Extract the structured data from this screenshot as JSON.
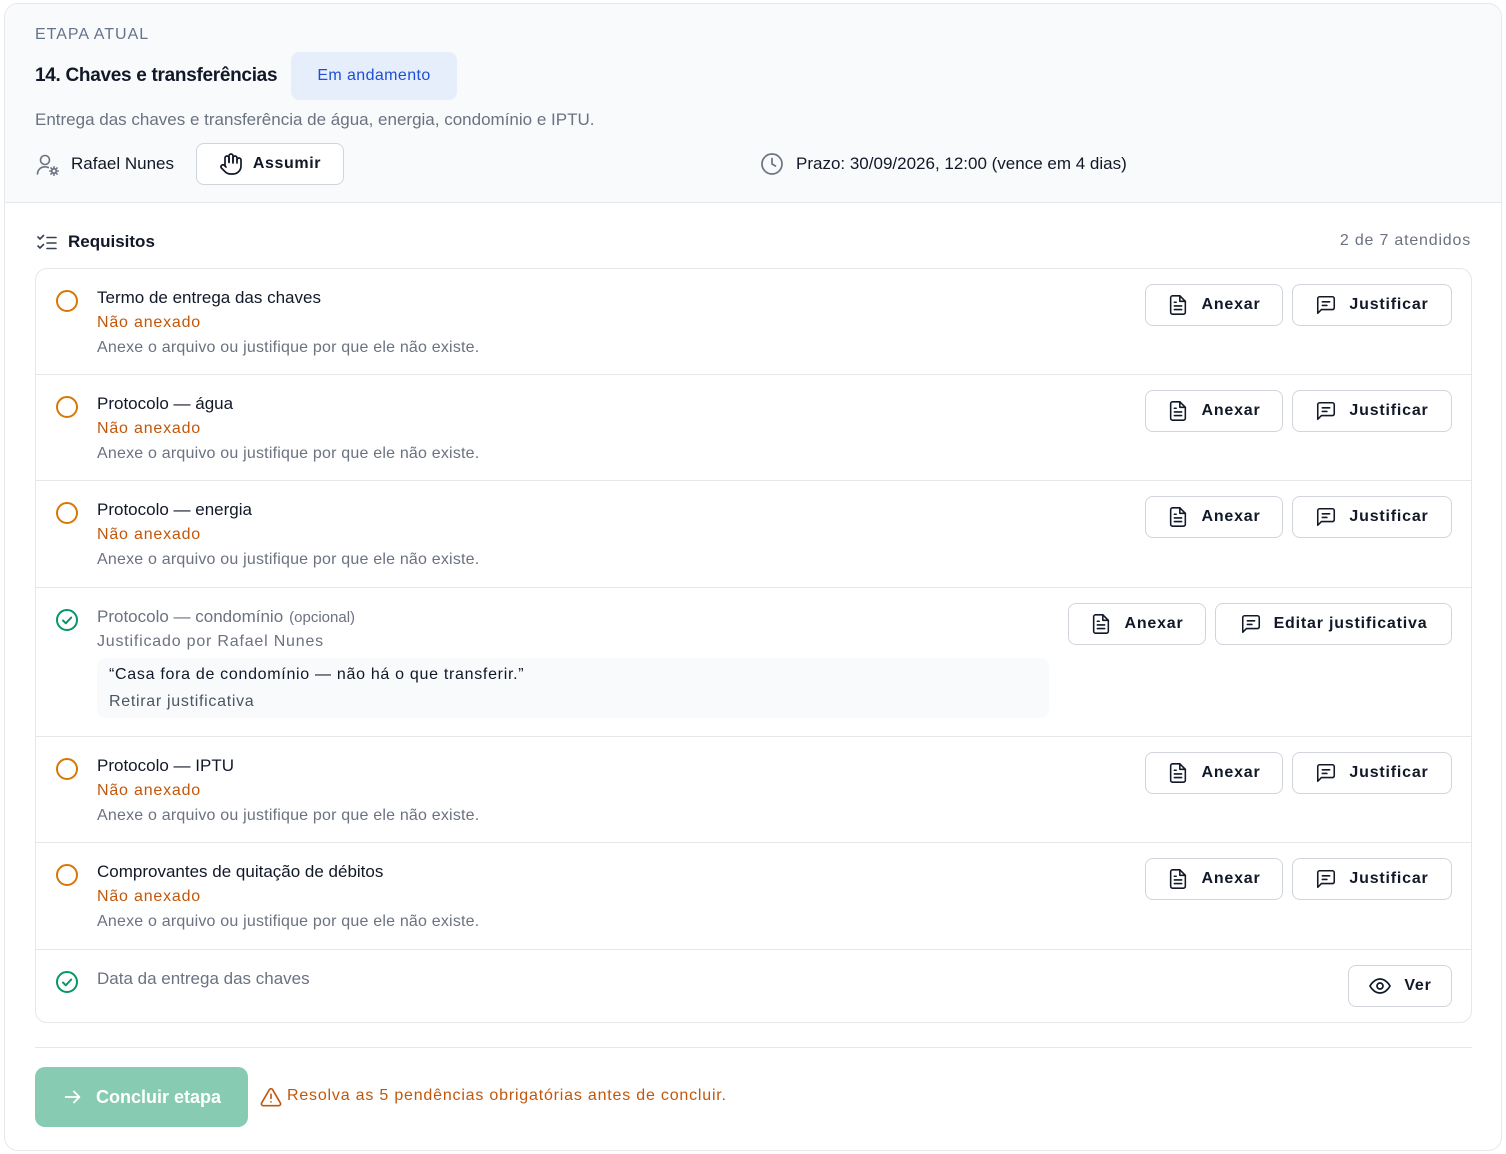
{
  "stage": {
    "eyebrow": "ETAPA ATUAL",
    "title": "14. Chaves e transferências",
    "status": "Em andamento",
    "description": "Entrega das chaves e transferência de água, energia, condomínio e IPTU.",
    "assignee": "Rafael Nunes",
    "assume_label": "Assumir",
    "deadline": "Prazo: 30/09/2026, 12:00 (vence em 4 dias)"
  },
  "requirements": {
    "title": "Requisitos",
    "count": "2 de 7 atendidos",
    "items": [
      {
        "name": "Termo de entrega das chaves",
        "status": "pending",
        "status_text": "Não anexado",
        "hint": "Anexe o arquivo ou justifique por que ele não existe.",
        "actions": [
          "Anexar",
          "Justificar"
        ]
      },
      {
        "name": "Protocolo — água",
        "status": "pending",
        "status_text": "Não anexado",
        "hint": "Anexe o arquivo ou justifique por que ele não existe.",
        "actions": [
          "Anexar",
          "Justificar"
        ]
      },
      {
        "name": "Protocolo — energia",
        "status": "pending",
        "status_text": "Não anexado",
        "hint": "Anexe o arquivo ou justifique por que ele não existe.",
        "actions": [
          "Anexar",
          "Justificar"
        ]
      },
      {
        "name": "Protocolo — condomínio",
        "optional_label": "(opcional)",
        "status": "done",
        "status_text": "Justificado por Rafael Nunes",
        "justification": "“Casa fora de condomínio — não há o que transferir.”",
        "remove_label": "Retirar justificativa",
        "actions": [
          "Anexar",
          "Editar justificativa"
        ]
      },
      {
        "name": "Protocolo — IPTU",
        "status": "pending",
        "status_text": "Não anexado",
        "hint": "Anexe o arquivo ou justifique por que ele não existe.",
        "actions": [
          "Anexar",
          "Justificar"
        ]
      },
      {
        "name": "Comprovantes de quitação de débitos",
        "status": "pending",
        "status_text": "Não anexado",
        "hint": "Anexe o arquivo ou justifique por que ele não existe.",
        "actions": [
          "Anexar",
          "Justificar"
        ]
      },
      {
        "name": "Data da entrega das chaves",
        "status": "done",
        "actions": [
          "Ver"
        ]
      }
    ]
  },
  "footer": {
    "conclude_label": "Concluir etapa",
    "warning": "Resolva as 5 pendências obrigatórias antes de concluir."
  },
  "colors": {
    "pending": "#d97706",
    "done": "#059669",
    "accent": "#1d4ed8",
    "conclude_disabled": "#86cbb2",
    "warning": "#c2570c"
  }
}
